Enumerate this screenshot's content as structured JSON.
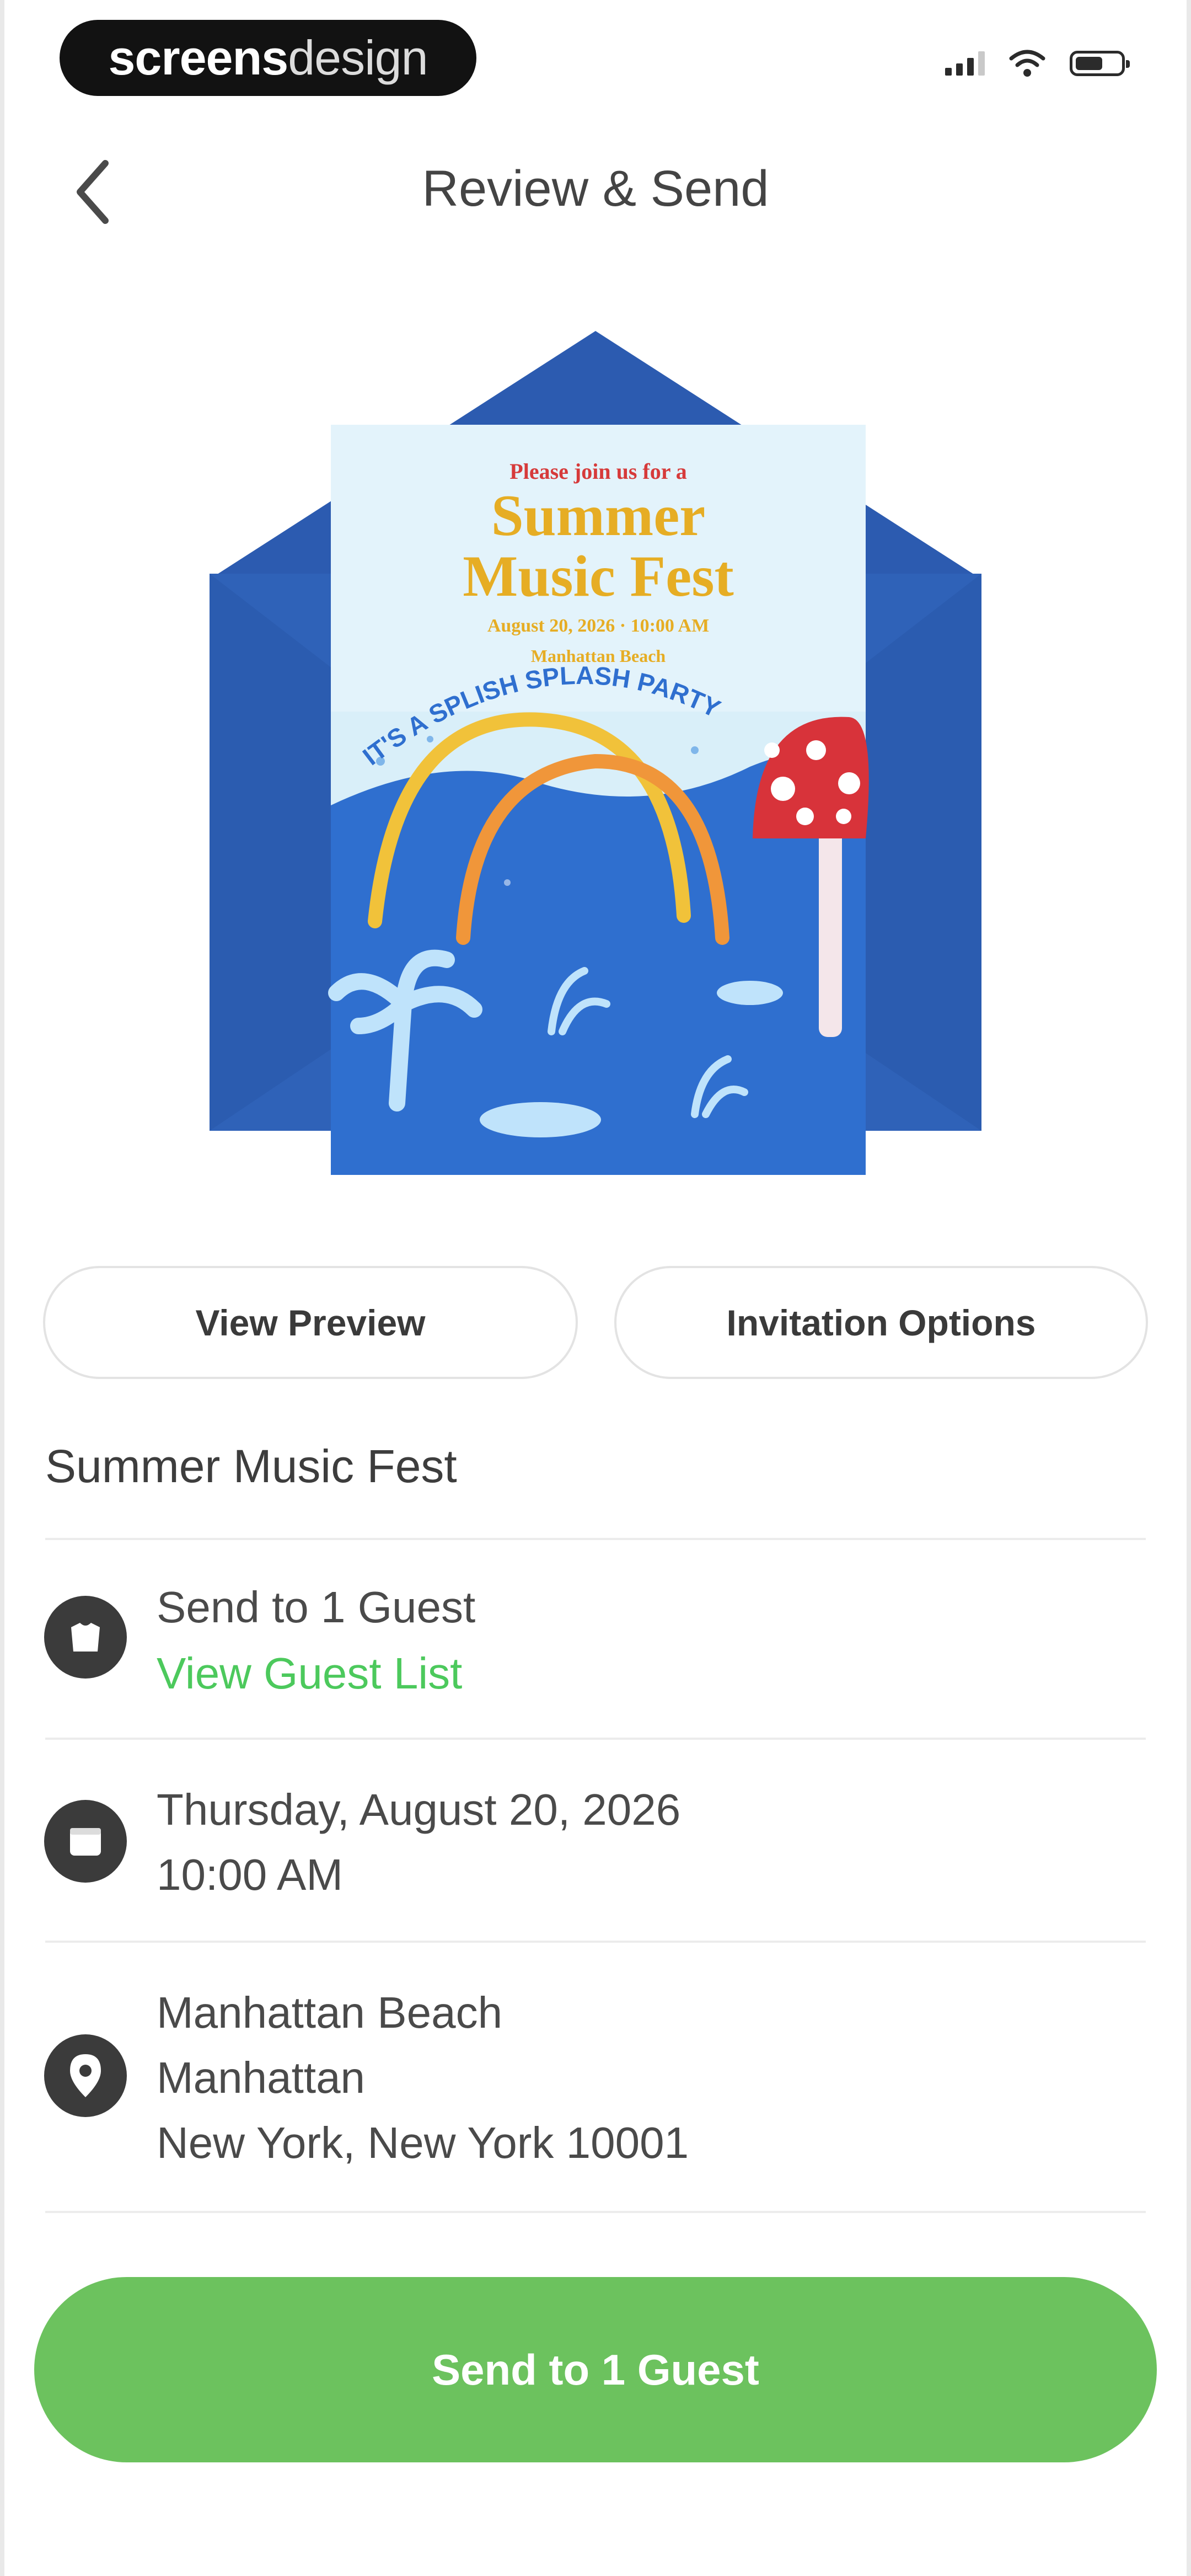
{
  "status_bar": {
    "brand_part1": "screens",
    "brand_part2": "design",
    "signal_icon": "cellular-signal-icon",
    "wifi_icon": "wifi-icon",
    "battery_icon": "battery-icon"
  },
  "nav": {
    "title": "Review & Send",
    "back_icon": "chevron-left-icon"
  },
  "invitation": {
    "invite_line": "Please join us for a",
    "title_line1": "Summer",
    "title_line2": "Music Fest",
    "date_line": "August 20, 2026 · 10:00 AM",
    "location_line": "Manhattan Beach",
    "arc_text": "IT'S A SPLISH SPLASH PARTY",
    "colors": {
      "envelope": "#2f5fb4",
      "card_sky": "#d6eefa",
      "card_water": "#2f6fcf",
      "title": "#e6ad24"
    }
  },
  "actions": {
    "view_preview": "View Preview",
    "invitation_options": "Invitation Options"
  },
  "event": {
    "title": "Summer Music Fest",
    "guests": {
      "icon": "guest-icon",
      "label": "Send to 1 Guest",
      "link": "View Guest List"
    },
    "datetime": {
      "icon": "calendar-icon",
      "date": "Thursday, August 20, 2026",
      "time": "10:00 AM"
    },
    "location": {
      "icon": "location-pin-icon",
      "line1": "Manhattan Beach",
      "line2": "Manhattan",
      "line3": "New York, New York 10001"
    }
  },
  "send_button": {
    "label": "Send to 1 Guest",
    "color": "#6cc25e"
  }
}
